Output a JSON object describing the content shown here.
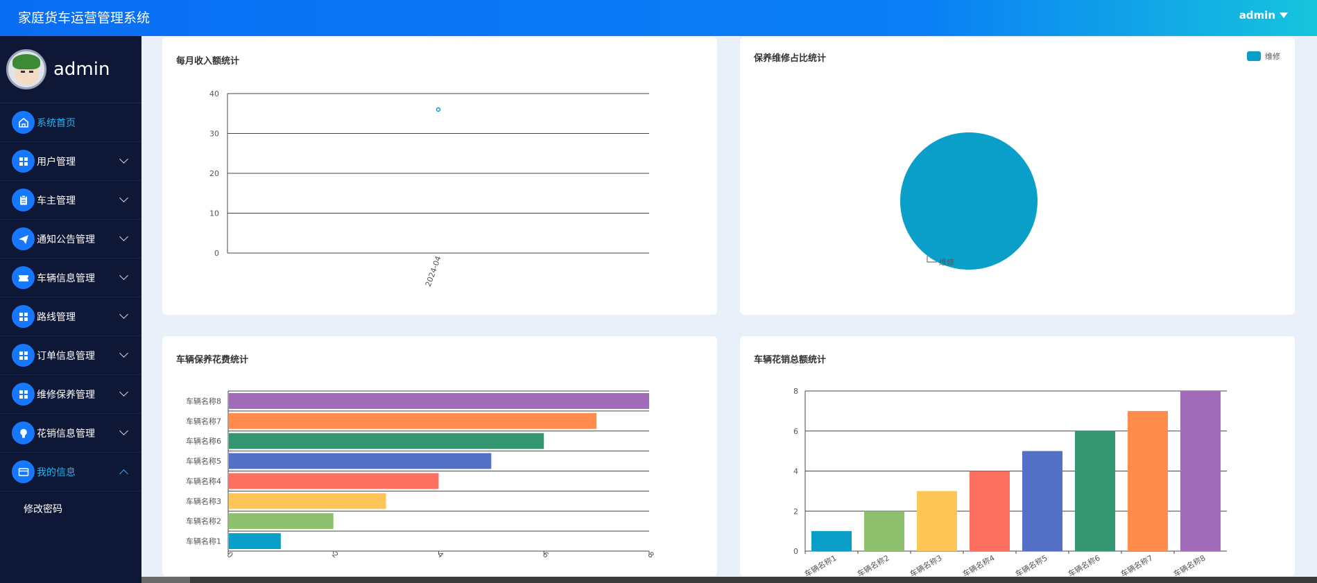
{
  "header": {
    "title": "家庭货车运营管理系统",
    "user": "admin"
  },
  "sidebar": {
    "profile_name": "admin",
    "items": [
      {
        "label": "系统首页",
        "icon": "home-icon"
      },
      {
        "label": "用户管理",
        "icon": "grid-icon"
      },
      {
        "label": "车主管理",
        "icon": "clipboard-icon"
      },
      {
        "label": "通知公告管理",
        "icon": "send-icon"
      },
      {
        "label": "车辆信息管理",
        "icon": "ticket-icon"
      },
      {
        "label": "路线管理",
        "icon": "grid-icon"
      },
      {
        "label": "订单信息管理",
        "icon": "grid-icon"
      },
      {
        "label": "维修保养管理",
        "icon": "grid-icon"
      },
      {
        "label": "花销信息管理",
        "icon": "bulb-icon"
      },
      {
        "label": "我的信息",
        "icon": "card-icon"
      }
    ],
    "subitems": [
      {
        "label": "修改密码"
      }
    ]
  },
  "cards": {
    "income": {
      "title": "每月收入额统计"
    },
    "ratio": {
      "title": "保养维修占比统计"
    },
    "maintenance": {
      "title": "车辆保养花费统计"
    },
    "expense": {
      "title": "车辆花销总额统计"
    }
  },
  "colors": {
    "accent": "#1677ff",
    "palette": [
      "#0a9fc9",
      "#8fc06d",
      "#fdc657",
      "#fd7061",
      "#5470c6",
      "#339671",
      "#ff8c4c",
      "#a06cba"
    ]
  },
  "chart_data": [
    {
      "type": "scatter",
      "title": "每月收入额统计",
      "x": [
        "2024-04"
      ],
      "y": [
        36
      ],
      "ylim": [
        0,
        40
      ],
      "yticks": [
        0,
        10,
        20,
        30,
        40
      ]
    },
    {
      "type": "pie",
      "title": "保养维修占比统计",
      "labels": [
        "维修"
      ],
      "values": [
        1
      ],
      "legend": "top-right"
    },
    {
      "type": "bar",
      "orientation": "horizontal",
      "title": "车辆保养花费统计",
      "categories": [
        "车辆名称1",
        "车辆名称2",
        "车辆名称3",
        "车辆名称4",
        "车辆名称5",
        "车辆名称6",
        "车辆名称7",
        "车辆名称8"
      ],
      "values": [
        1,
        2,
        3,
        4,
        5,
        6,
        7,
        8
      ],
      "xlim": [
        0,
        8
      ],
      "xticks": [
        "0",
        "2",
        "4",
        "6",
        "8"
      ]
    },
    {
      "type": "bar",
      "title": "车辆花销总额统计",
      "categories": [
        "车辆名称1",
        "车辆名称2",
        "车辆名称3",
        "车辆名称4",
        "车辆名称5",
        "车辆名称6",
        "车辆名称7",
        "车辆名称8"
      ],
      "values": [
        1,
        2,
        3,
        4,
        5,
        6,
        7,
        8
      ],
      "ylim": [
        0,
        8
      ],
      "yticks": [
        0,
        2,
        4,
        6,
        8
      ]
    }
  ]
}
